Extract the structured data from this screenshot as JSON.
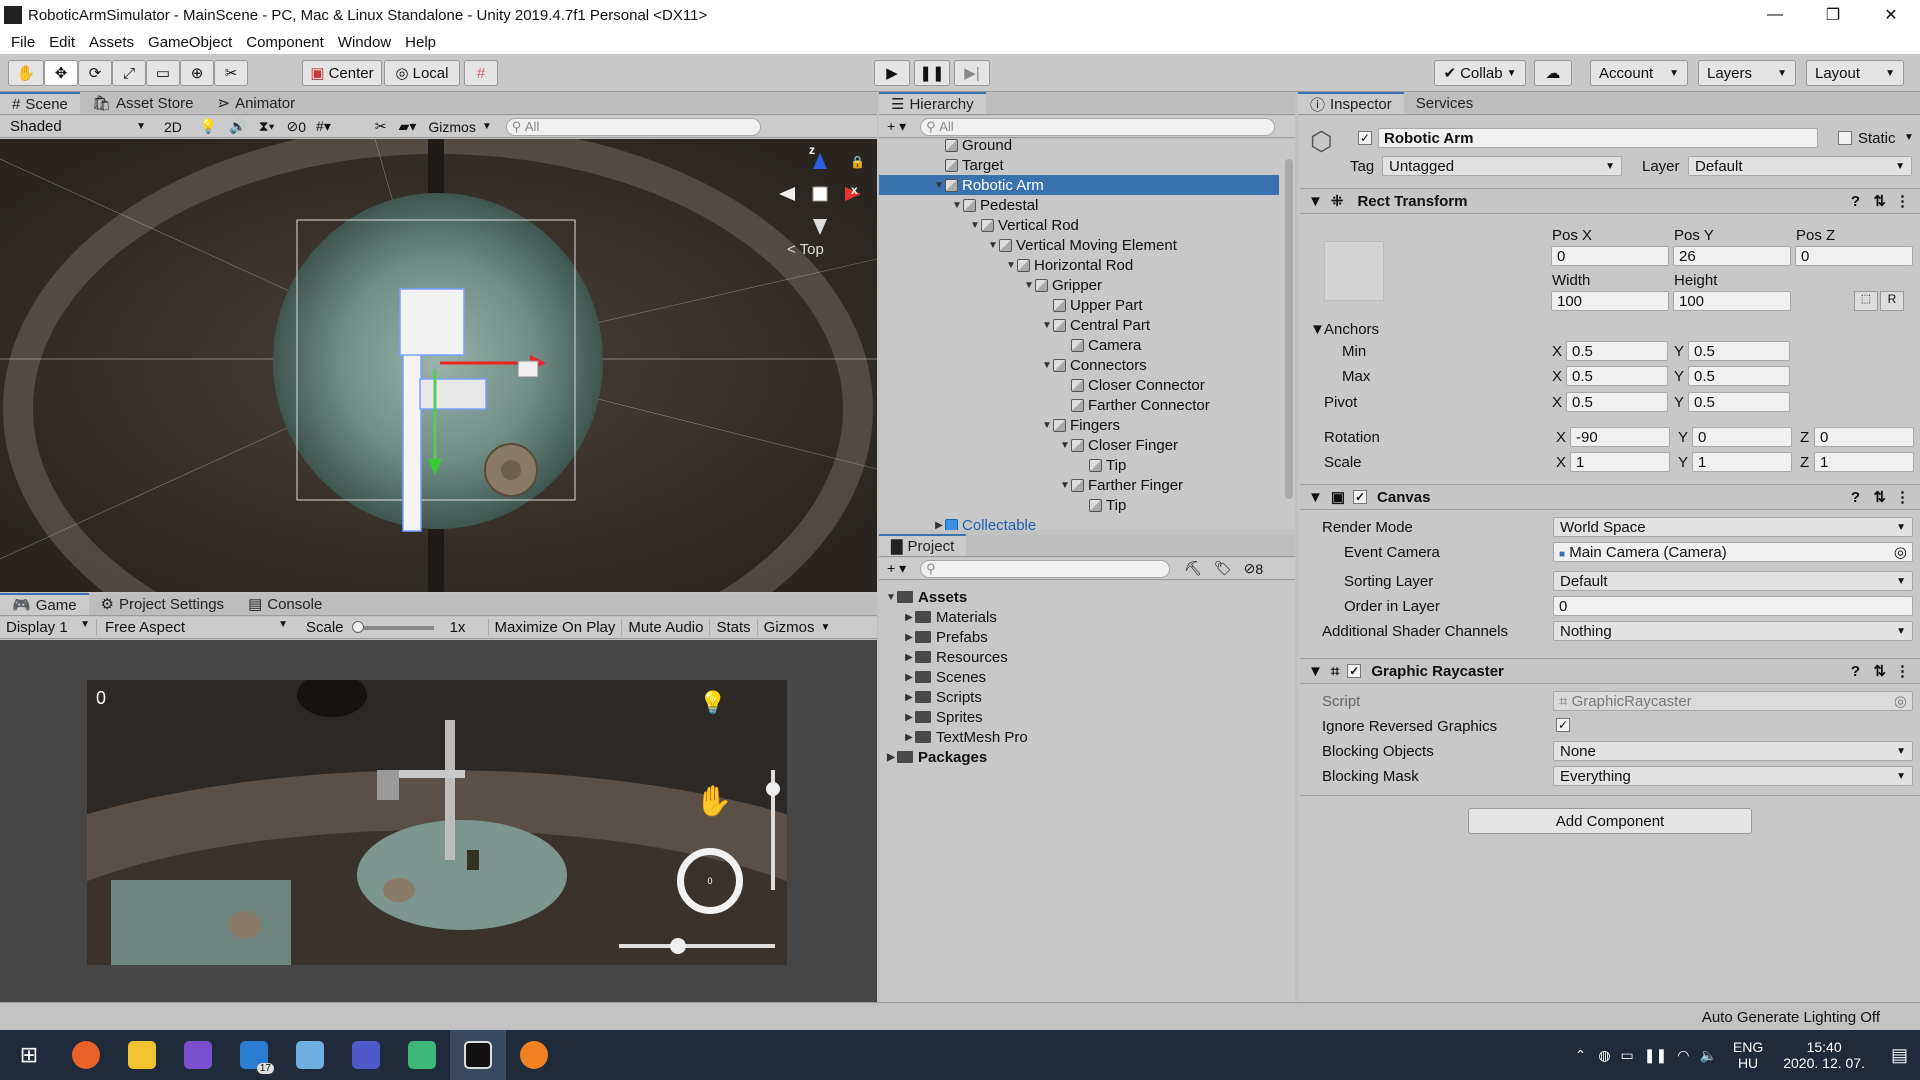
{
  "title": "RoboticArmSimulator - MainScene - PC, Mac & Linux Standalone - Unity 2019.4.7f1 Personal <DX11>",
  "menu": [
    "File",
    "Edit",
    "Assets",
    "GameObject",
    "Component",
    "Window",
    "Help"
  ],
  "toolbar": {
    "center": "Center",
    "local": "Local",
    "collab": "Collab",
    "account": "Account",
    "layers": "Layers",
    "layout": "Layout"
  },
  "scene": {
    "tabs": [
      "Scene",
      "Asset Store",
      "Animator"
    ],
    "shading": "Shaded",
    "mode2d": "2D",
    "hidden_count": "0",
    "gizmos": "Gizmos",
    "search_placeholder": "All",
    "axis_z": "z",
    "axis_x": "x",
    "view_label": "< Top"
  },
  "game": {
    "tabs": [
      "Game",
      "Project Settings",
      "Console"
    ],
    "display": "Display 1",
    "aspect": "Free Aspect",
    "scale_label": "Scale",
    "scale_value": "1x",
    "buttons": [
      "Maximize On Play",
      "Mute Audio",
      "Stats",
      "Gizmos"
    ],
    "score": "0",
    "joystick_value": "0"
  },
  "hierarchy": {
    "tab": "Hierarchy",
    "search_placeholder": "All",
    "items": [
      {
        "label": "Ground",
        "depth": 0,
        "arrow": ""
      },
      {
        "label": "Target",
        "depth": 0,
        "arrow": ""
      },
      {
        "label": "Robotic Arm",
        "depth": 0,
        "arrow": "▼",
        "selected": true
      },
      {
        "label": "Pedestal",
        "depth": 1,
        "arrow": "▼"
      },
      {
        "label": "Vertical Rod",
        "depth": 2,
        "arrow": "▼"
      },
      {
        "label": "Vertical Moving Element",
        "depth": 3,
        "arrow": "▼"
      },
      {
        "label": "Horizontal Rod",
        "depth": 4,
        "arrow": "▼"
      },
      {
        "label": "Gripper",
        "depth": 5,
        "arrow": "▼"
      },
      {
        "label": "Upper Part",
        "depth": 6,
        "arrow": ""
      },
      {
        "label": "Central Part",
        "depth": 6,
        "arrow": "▼"
      },
      {
        "label": "Camera",
        "depth": 7,
        "arrow": ""
      },
      {
        "label": "Connectors",
        "depth": 6,
        "arrow": "▼"
      },
      {
        "label": "Closer Connector",
        "depth": 7,
        "arrow": ""
      },
      {
        "label": "Farther Connector",
        "depth": 7,
        "arrow": ""
      },
      {
        "label": "Fingers",
        "depth": 6,
        "arrow": "▼"
      },
      {
        "label": "Closer Finger",
        "depth": 7,
        "arrow": "▼"
      },
      {
        "label": "Tip",
        "depth": 8,
        "arrow": ""
      },
      {
        "label": "Farther Finger",
        "depth": 7,
        "arrow": "▼"
      },
      {
        "label": "Tip",
        "depth": 8,
        "arrow": ""
      },
      {
        "label": "Collectable",
        "depth": 0,
        "arrow": "▶",
        "prefab": true
      }
    ]
  },
  "project": {
    "tab": "Project",
    "hidden_count": "8",
    "assets_label": "Assets",
    "folders": [
      "Materials",
      "Prefabs",
      "Resources",
      "Scenes",
      "Scripts",
      "Sprites",
      "TextMesh Pro"
    ],
    "packages_label": "Packages"
  },
  "inspector": {
    "tabs": [
      "Inspector",
      "Services"
    ],
    "object_name": "Robotic Arm",
    "static_label": "Static",
    "tag_label": "Tag",
    "tag_value": "Untagged",
    "layer_label": "Layer",
    "layer_value": "Default",
    "rect": {
      "title": "Rect Transform",
      "posx_label": "Pos X",
      "posy_label": "Pos Y",
      "posz_label": "Pos Z",
      "posx": "0",
      "posy": "26",
      "posz": "0",
      "width_label": "Width",
      "height_label": "Height",
      "width": "100",
      "height": "100",
      "r_button": "R",
      "anchors": "Anchors",
      "min": "Min",
      "max": "Max",
      "pivot": "Pivot",
      "min_x": "0.5",
      "min_y": "0.5",
      "max_x": "0.5",
      "max_y": "0.5",
      "pivot_x": "0.5",
      "pivot_y": "0.5",
      "rotation": "Rotation",
      "rot_x": "-90",
      "rot_y": "0",
      "rot_z": "0",
      "scale": "Scale",
      "scale_x": "1",
      "scale_y": "1",
      "scale_z": "1",
      "x": "X",
      "y": "Y",
      "z": "Z"
    },
    "canvas": {
      "title": "Canvas",
      "render_mode_label": "Render Mode",
      "render_mode": "World Space",
      "event_camera_label": "Event Camera",
      "event_camera": "Main Camera (Camera)",
      "sorting_layer_label": "Sorting Layer",
      "sorting_layer": "Default",
      "order_label": "Order in Layer",
      "order": "0",
      "shader_label": "Additional Shader Channels",
      "shader": "Nothing"
    },
    "raycaster": {
      "title": "Graphic Raycaster",
      "script_label": "Script",
      "script": "GraphicRaycaster",
      "ignore_label": "Ignore Reversed Graphics",
      "blocking_objects_label": "Blocking Objects",
      "blocking_objects": "None",
      "blocking_mask_label": "Blocking Mask",
      "blocking_mask": "Everything"
    },
    "add_component": "Add Component"
  },
  "status": "Auto Generate Lighting Off",
  "taskbar": {
    "lang": "ENG",
    "region": "HU",
    "time": "15:40",
    "date": "2020. 12. 07.",
    "badge": "17"
  }
}
